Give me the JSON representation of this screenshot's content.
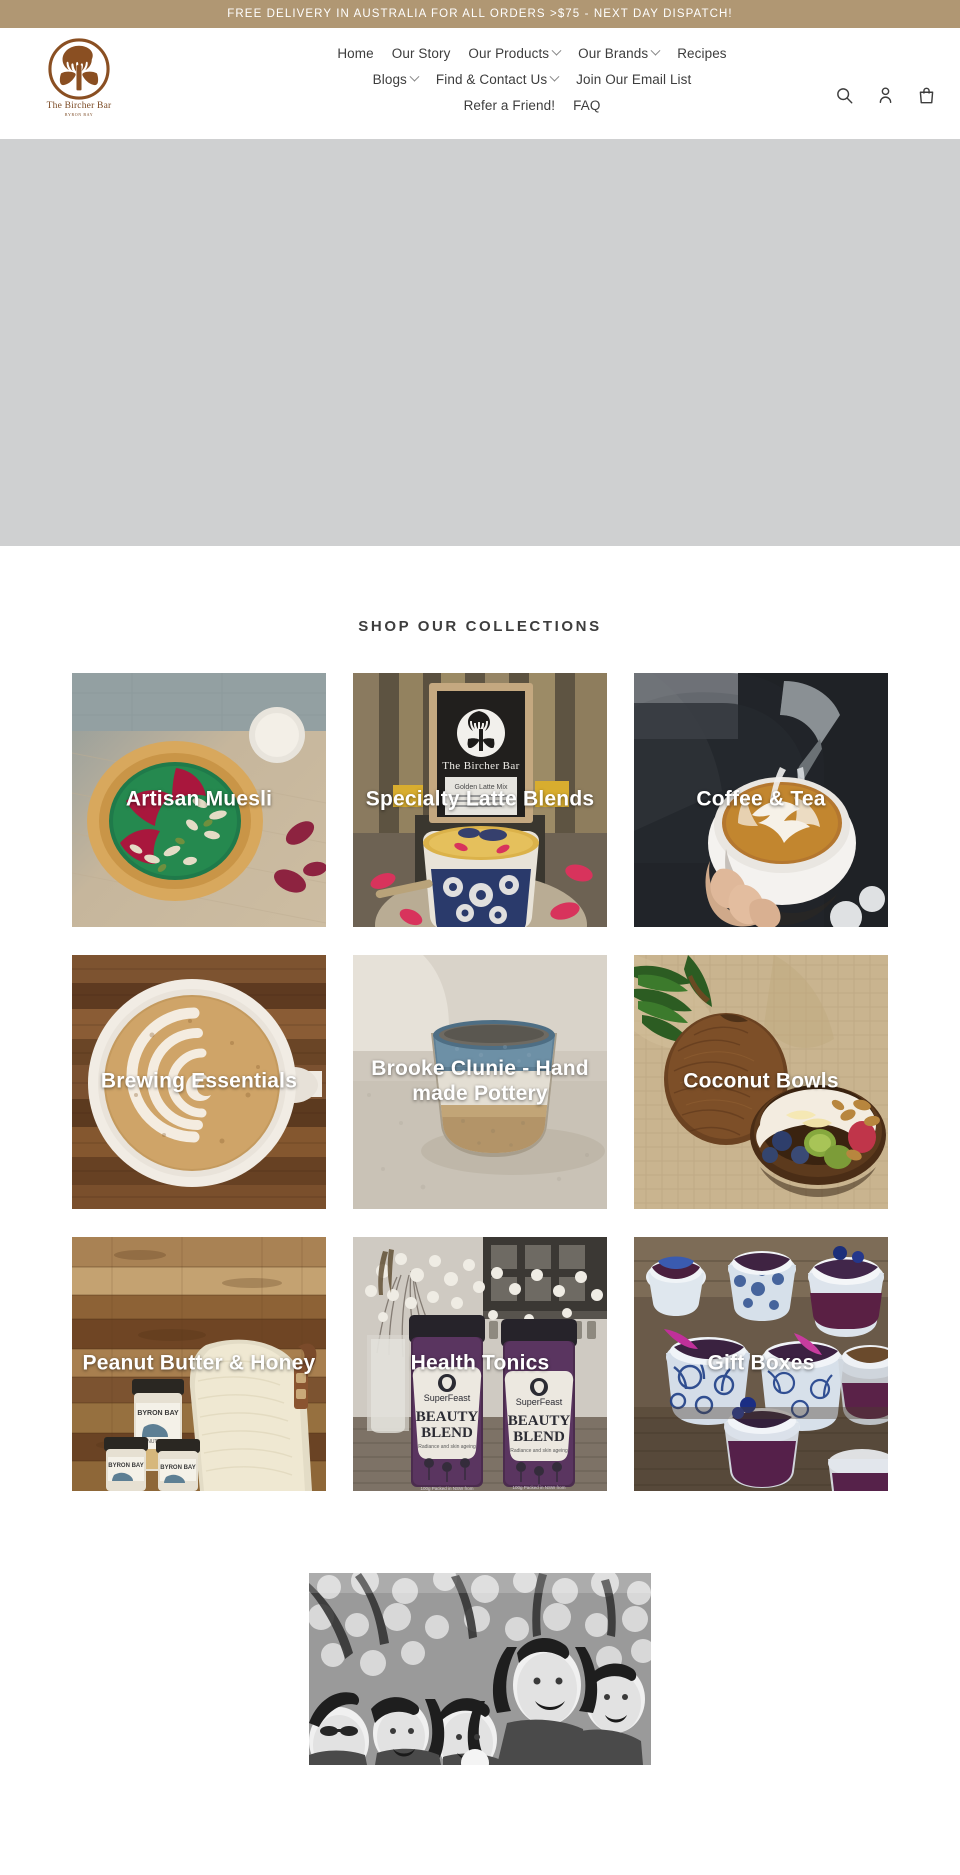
{
  "announcement": {
    "text": "FREE DELIVERY IN AUSTRALIA FOR ALL ORDERS >$75 - NEXT DAY DISPATCH!",
    "background": "#b09773",
    "color": "#ffffff"
  },
  "header": {
    "logo": {
      "name": "The Bircher Bar",
      "tagline": "BYRON BAY",
      "icon": "tree-in-circle-logo",
      "color": "#7b4a24"
    },
    "nav_rows": [
      [
        {
          "label": "Home",
          "has_dropdown": false
        },
        {
          "label": "Our Story",
          "has_dropdown": false
        },
        {
          "label": "Our Products",
          "has_dropdown": true
        },
        {
          "label": "Our Brands",
          "has_dropdown": true
        },
        {
          "label": "Recipes",
          "has_dropdown": false
        }
      ],
      [
        {
          "label": "Blogs",
          "has_dropdown": true
        },
        {
          "label": "Find & Contact Us",
          "has_dropdown": true
        },
        {
          "label": "Join Our Email List",
          "has_dropdown": false
        }
      ],
      [
        {
          "label": "Refer a Friend!",
          "has_dropdown": false
        },
        {
          "label": "FAQ",
          "has_dropdown": false
        }
      ]
    ],
    "icons": [
      {
        "name": "search-icon",
        "label": "Search"
      },
      {
        "name": "account-icon",
        "label": "Log in"
      },
      {
        "name": "cart-icon",
        "label": "Cart"
      }
    ]
  },
  "hero": {
    "placeholder_color": "#cfd0d1"
  },
  "collections": {
    "title": "SHOP OUR COLLECTIONS",
    "tiles": [
      {
        "label": "Artisan Muesli",
        "image": "green-smoothie-bowl-wooden-bowl"
      },
      {
        "label": "Specialty Latte Blends",
        "image": "golden-latte-mix-pouch-and-cup"
      },
      {
        "label": "Coffee & Tea",
        "image": "barista-pouring-latte-art"
      },
      {
        "label": "Brewing Essentials",
        "image": "latte-top-view-on-wood"
      },
      {
        "label": "Brooke Clunie - Hand made Pottery",
        "image": "handmade-ceramic-cup"
      },
      {
        "label": "Coconut Bowls",
        "image": "coconut-and-fruit-bowl-on-hessian"
      },
      {
        "label": "Peanut Butter & Honey",
        "image": "byron-bay-peanut-butter-jars"
      },
      {
        "label": "Health Tonics",
        "image": "superfeast-beauty-blend-jars"
      },
      {
        "label": "Gift Boxes",
        "image": "blue-white-cups-with-berry-parfait"
      }
    ]
  },
  "team_section": {
    "image": "black-and-white-group-photo-outdoors"
  }
}
